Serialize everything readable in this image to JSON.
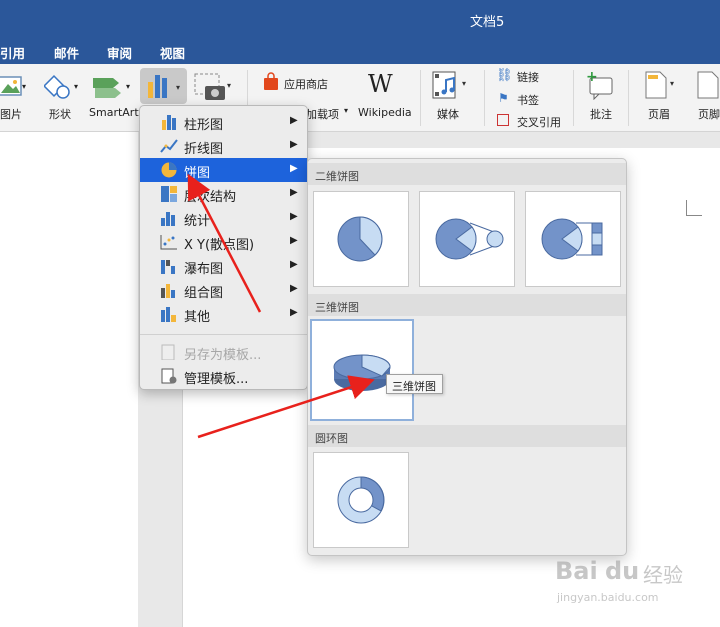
{
  "window": {
    "title": "文档5"
  },
  "tabs": [
    "引用",
    "邮件",
    "审阅",
    "视图"
  ],
  "ribbon": {
    "picture_label": "图片",
    "shapes_label": "形状",
    "smartart_label": "SmartArt",
    "app_store_label": "应用商店",
    "addins_label": "加载项",
    "wikipedia_label": "Wikipedia",
    "wikipedia_glyph": "W",
    "media_label": "媒体",
    "link_label": "链接",
    "bookmark_label": "书签",
    "crossref_label": "交叉引用",
    "comment_label": "批注",
    "header_label": "页眉",
    "footer_label": "页脚"
  },
  "chart_menu": {
    "items": [
      {
        "label": "柱形图",
        "icon": "column-chart-icon",
        "submenu": true
      },
      {
        "label": "折线图",
        "icon": "line-chart-icon",
        "submenu": true
      },
      {
        "label": "饼图",
        "icon": "pie-chart-icon",
        "submenu": true,
        "selected": true
      },
      {
        "label": "层次结构",
        "icon": "hierarchy-chart-icon",
        "submenu": true
      },
      {
        "label": "统计",
        "icon": "statistic-chart-icon",
        "submenu": true
      },
      {
        "label": "X Y(散点图)",
        "icon": "scatter-chart-icon",
        "submenu": true
      },
      {
        "label": "瀑布图",
        "icon": "waterfall-chart-icon",
        "submenu": true
      },
      {
        "label": "组合图",
        "icon": "combo-chart-icon",
        "submenu": true
      },
      {
        "label": "其他",
        "icon": "other-chart-icon",
        "submenu": true
      }
    ],
    "save_template": "另存为模板...",
    "manage_template": "管理模板...",
    "arrow_glyph": "▶"
  },
  "gallery": {
    "section_2d": "二维饼图",
    "section_3d": "三维饼图",
    "section_donut": "圆环图",
    "tooltip": "三维饼图"
  },
  "watermark": {
    "brand": "Bai",
    "brand2": "du",
    "brand_cn": "经验",
    "url": "jingyan.baidu.com"
  },
  "colors": {
    "accent": "#2b579a",
    "selected": "#1d63dc",
    "pie_dark": "#7393c9",
    "pie_light": "#c7dcf3",
    "arrow": "#e8211c"
  }
}
